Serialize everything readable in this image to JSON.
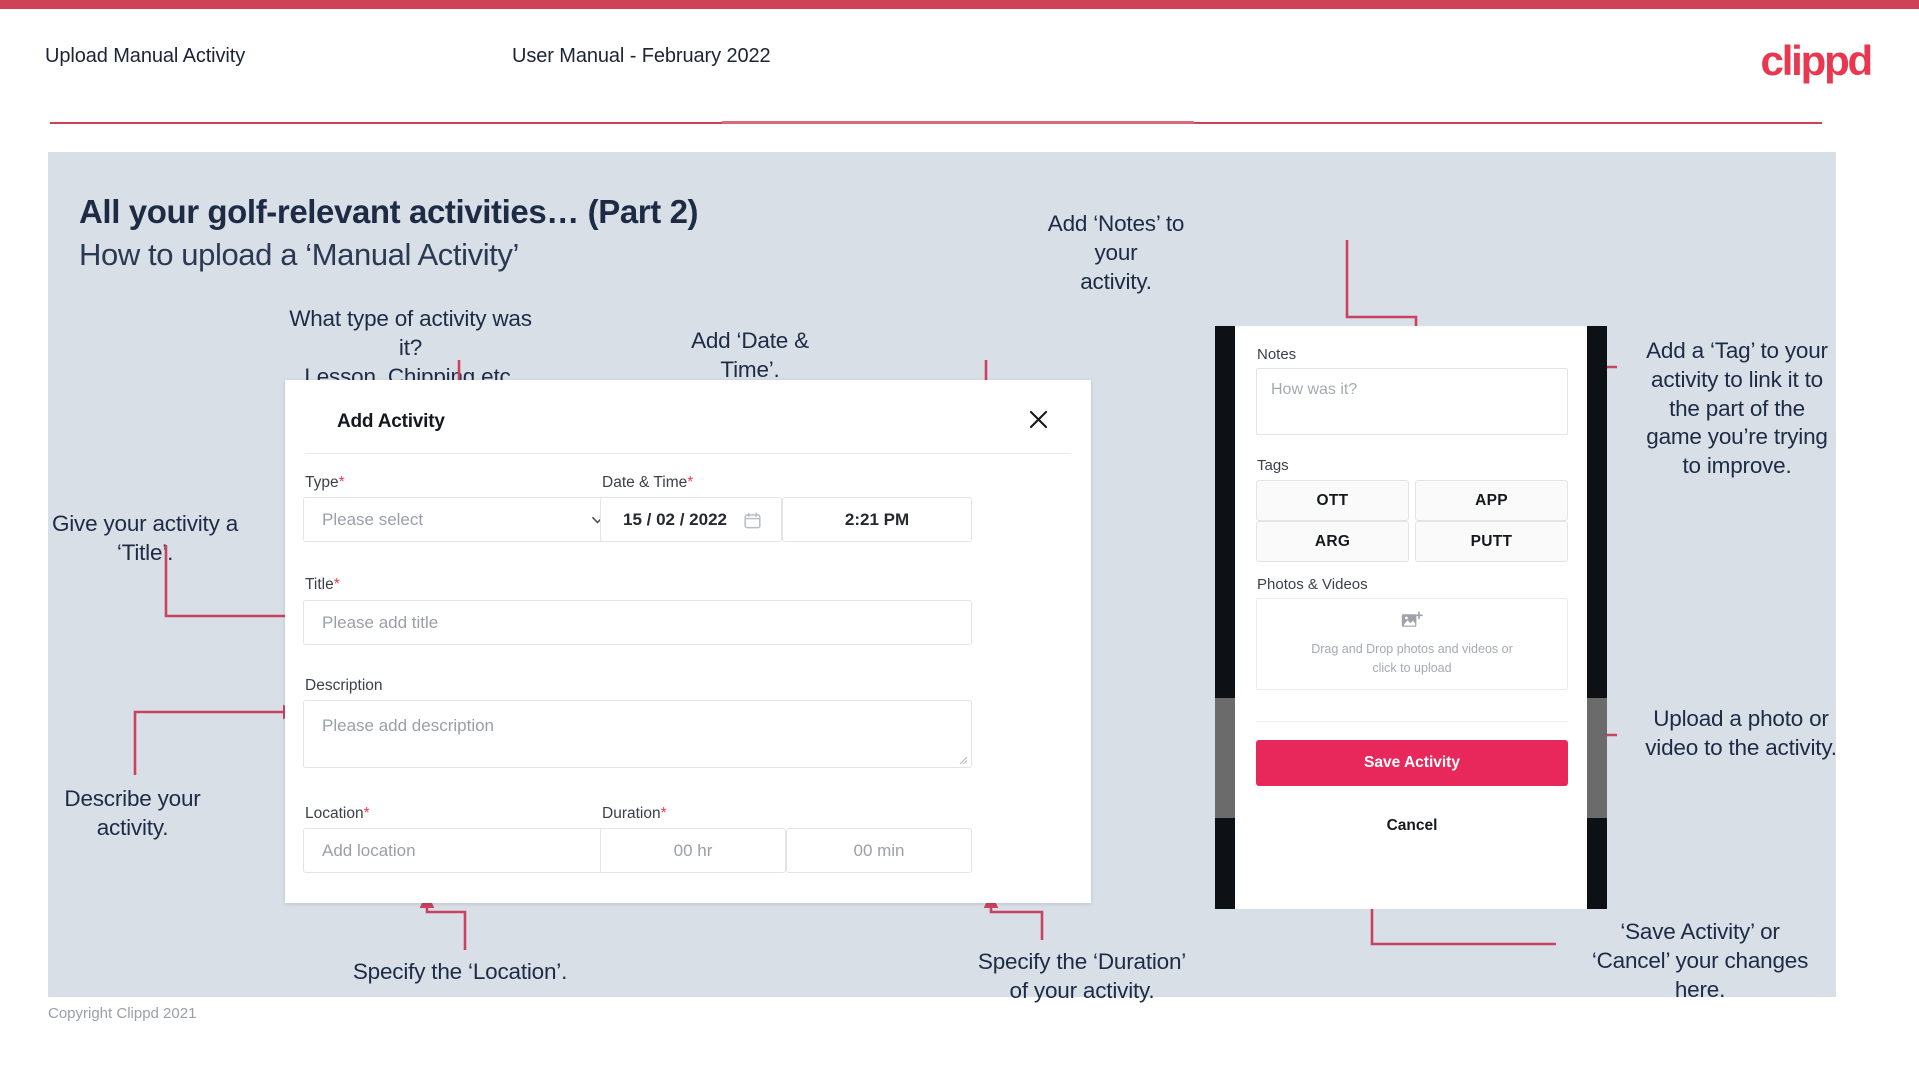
{
  "header": {
    "title": "Upload Manual Activity",
    "subtitle": "User Manual - February 2022",
    "logo": "clippd"
  },
  "slide": {
    "heading": "All your golf-relevant activities… (Part 2)",
    "subheading": "How to upload a ‘Manual Activity’"
  },
  "annotations": {
    "type": "What type of activity was it?\nLesson, Chipping etc.",
    "datetime": "Add ‘Date & Time’.",
    "notes": "Add ‘Notes’ to your\nactivity.",
    "tag": "Add a ‘Tag’ to your\nactivity to link it to\nthe part of the\ngame you’re trying\nto improve.",
    "title": "Give your activity a\n‘Title’.",
    "describe": "Describe your\nactivity.",
    "location": "Specify the ‘Location’.",
    "duration": "Specify the ‘Duration’\nof your activity.",
    "upload": "Upload a photo or\nvideo to the activity.",
    "save": "‘Save Activity’ or\n‘Cancel’ your changes\nhere."
  },
  "dialog": {
    "title": "Add Activity",
    "close_icon": "close-icon",
    "fields": {
      "type_label": "Type",
      "type_required": "*",
      "type_placeholder": "Please select",
      "datetime_label": "Date & Time",
      "datetime_required": "*",
      "date_value": "15 / 02 / 2022",
      "time_value": "2:21 PM",
      "title_label": "Title",
      "title_required": "*",
      "title_placeholder": "Please add title",
      "description_label": "Description",
      "description_placeholder": "Please add description",
      "location_label": "Location",
      "location_required": "*",
      "location_placeholder": "Add location",
      "duration_label": "Duration",
      "duration_required": "*",
      "duration_hr_placeholder": "00 hr",
      "duration_min_placeholder": "00 min"
    }
  },
  "phone": {
    "notes_label": "Notes",
    "notes_placeholder": "How was it?",
    "tags_label": "Tags",
    "tags": [
      "OTT",
      "APP",
      "ARG",
      "PUTT"
    ],
    "photos_label": "Photos & Videos",
    "drop_text": "Drag and Drop photos and videos or\nclick to upload",
    "drop_icon": "add-image-icon",
    "save_label": "Save Activity",
    "cancel_label": "Cancel"
  },
  "footer": {
    "copyright": "Copyright Clippd 2021"
  },
  "colors": {
    "accent": "#ce4158",
    "brand": "#e8374f",
    "save": "#e8285a",
    "slide_bg": "#d8dfe7",
    "text_dark": "#1d2b45"
  }
}
